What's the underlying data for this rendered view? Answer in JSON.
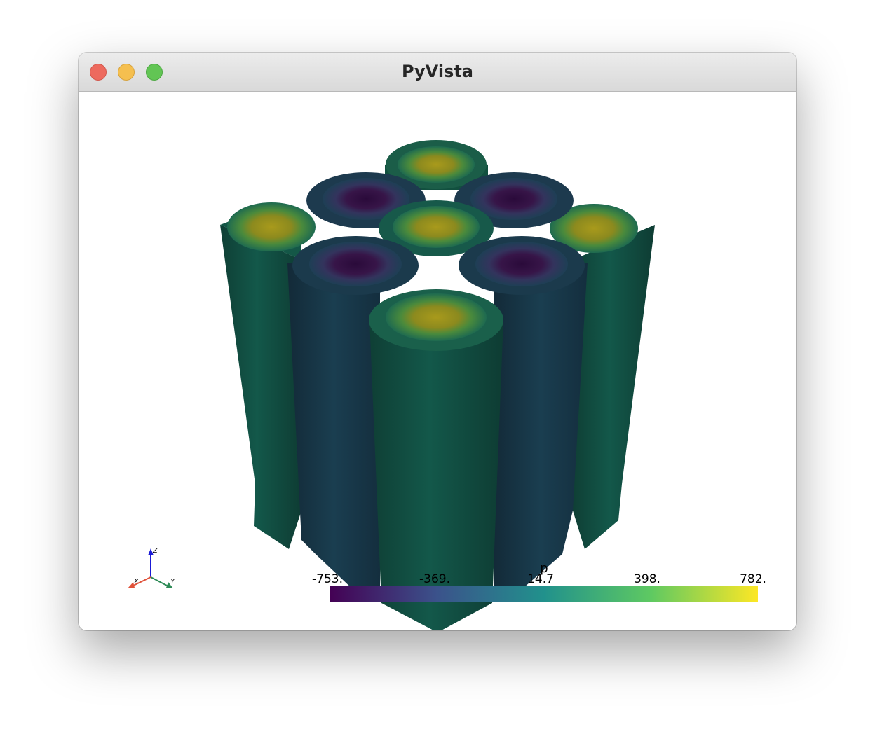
{
  "window": {
    "title": "PyVista"
  },
  "buttons": {
    "close": "close-button",
    "minimize": "minimize-button",
    "maximize": "zoom-button"
  },
  "scalar_bar": {
    "title": "p",
    "ticks": [
      "-753.",
      "-369.",
      "14.7",
      "398.",
      "782."
    ],
    "colormap": [
      "#440154",
      "#3b528b",
      "#21918c",
      "#5ec962",
      "#fde725"
    ]
  },
  "axes_widget": {
    "x_label": "X",
    "y_label": "Y",
    "z_label": "Z",
    "x_color": "#e0523a",
    "y_color": "#2e8b57",
    "z_color": "#1a1ad6"
  },
  "colors": {
    "dark_purple": "#2a0a3a",
    "yellow": "#9a8d1a",
    "teal_dark": "#114a3e",
    "blue_dark": "#173648"
  }
}
